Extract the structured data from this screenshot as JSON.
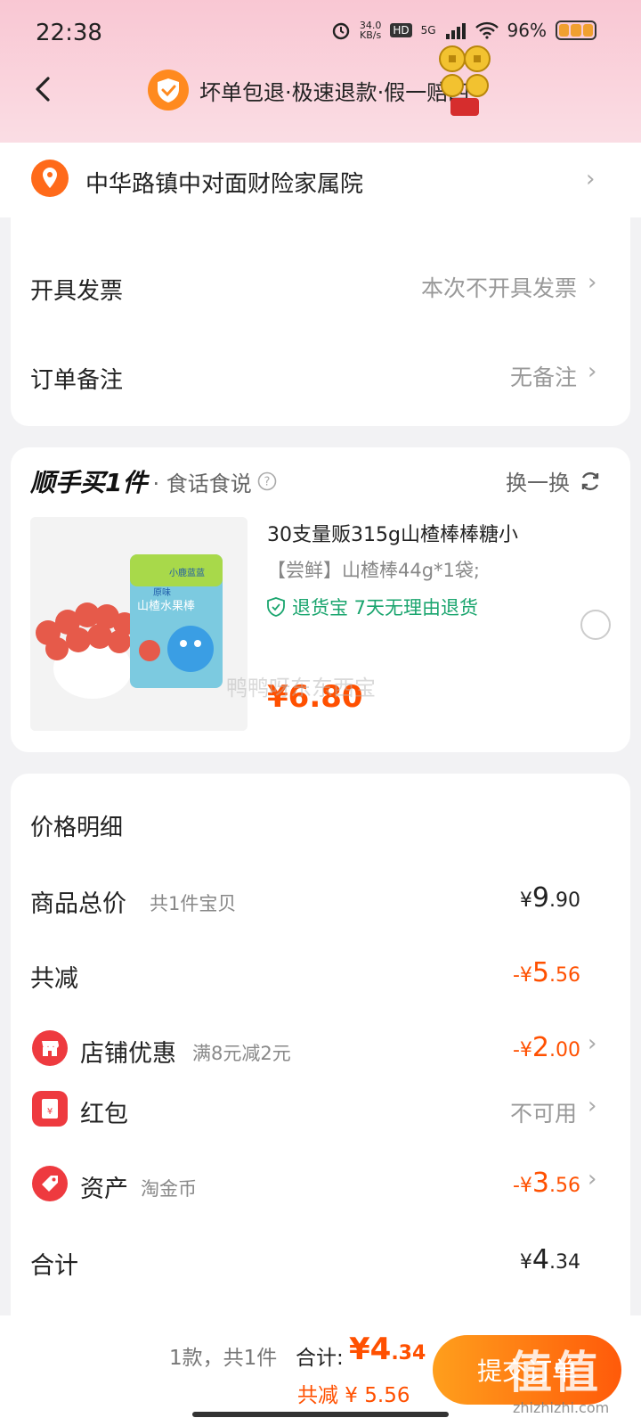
{
  "status_bar": {
    "time": "22:38",
    "net_speed_value": "34.0",
    "net_speed_unit": "KB/s",
    "hd": "HD",
    "network": "5G",
    "battery": "96%"
  },
  "header": {
    "guarantee_text": "坏单包退·极速退款·假一赔四"
  },
  "address": {
    "text": "中华路镇中对面财险家属院"
  },
  "options": {
    "invoice_label": "开具发票",
    "invoice_value": "本次不开具发票",
    "note_label": "订单备注",
    "note_value": "无备注"
  },
  "addon": {
    "title": "顺手买1件",
    "subtitle": "· 食话食说",
    "refresh": "换一换",
    "product": {
      "title": "30支量贩315g山楂棒棒糖小",
      "spec": "【尝鲜】山楂棒44g*1袋;",
      "tag": "退货宝  7天无理由退货",
      "price": "¥6.80",
      "pack_brand": "小鹿蓝蓝",
      "pack_line1": "原味",
      "pack_line2": "山楂水果棒"
    },
    "watermark": "鸭鸭呀东东西宝"
  },
  "price_detail": {
    "heading": "价格明细",
    "rows": {
      "total_label": "商品总价",
      "total_sub": "共1件宝贝",
      "total_amt_yen": "¥",
      "total_amt_int": "9",
      "total_amt_dec": ".90",
      "reduce_label": "共减",
      "reduce_amt_prefix": "-¥",
      "reduce_amt_int": "5",
      "reduce_amt_dec": ".56",
      "shop_label": "店铺优惠",
      "shop_sub": "满8元减2元",
      "shop_amt_prefix": "-¥",
      "shop_amt_int": "2",
      "shop_amt_dec": ".00",
      "hongbao_label": "红包",
      "hongbao_value": "不可用",
      "asset_label": "资产",
      "asset_sub": "淘金币",
      "asset_amt_prefix": "-¥",
      "asset_amt_int": "3",
      "asset_amt_dec": ".56",
      "sum_label": "合计",
      "sum_amt_yen": "¥",
      "sum_amt_int": "4",
      "sum_amt_dec": ".34"
    }
  },
  "bottom_bar": {
    "count": "1款，共1件",
    "total_label": "合计:",
    "total_int": "¥4",
    "total_dec": ".34",
    "saved": "共减 ¥ 5.56",
    "submit": "提交订单",
    "watermark_big": "值值值",
    "watermark_url": "zhizhizhi.com"
  },
  "colors": {
    "accent": "#ff5000",
    "green": "#1aa56e",
    "header_pink": "#f9c7d3"
  }
}
